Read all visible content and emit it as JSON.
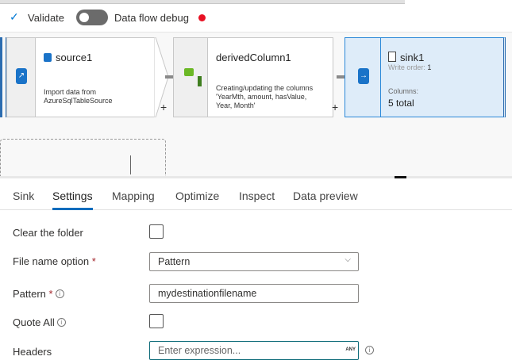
{
  "toolbar": {
    "validate_label": "Validate",
    "debug_label": "Data flow debug",
    "debug_on": false,
    "debug_status_color": "#e81123"
  },
  "nodes": [
    {
      "title": "source1",
      "desc_line1": "Import data from",
      "desc_line2": "AzureSqlTableSource"
    },
    {
      "title": "derivedColumn1",
      "desc_line1": "Creating/updating the columns",
      "desc_line2": "'YearMth, amount, hasValue,",
      "desc_line3": "Year, Month'"
    },
    {
      "title": "sink1",
      "write_order_label": "Write order:",
      "write_order": "1",
      "columns_label": "Columns:",
      "columns_value": "5 total"
    }
  ],
  "plus": "+",
  "tabs": [
    {
      "label": "Sink"
    },
    {
      "label": "Settings",
      "active": true
    },
    {
      "label": "Mapping"
    },
    {
      "label": "Optimize"
    },
    {
      "label": "Inspect"
    },
    {
      "label": "Data preview"
    }
  ],
  "form": {
    "clear_folder": {
      "label": "Clear the folder",
      "checked": false
    },
    "file_name_option": {
      "label": "File name option",
      "required": "*",
      "value": "Pattern"
    },
    "pattern": {
      "label": "Pattern",
      "required": "*",
      "value": "mydestinationfilename"
    },
    "quote_all": {
      "label": "Quote All",
      "checked": false
    },
    "headers": {
      "label": "Headers",
      "placeholder": "Enter expression...",
      "type_badge": "ANY"
    }
  },
  "info_glyph": "i",
  "accent": "#0078d4"
}
